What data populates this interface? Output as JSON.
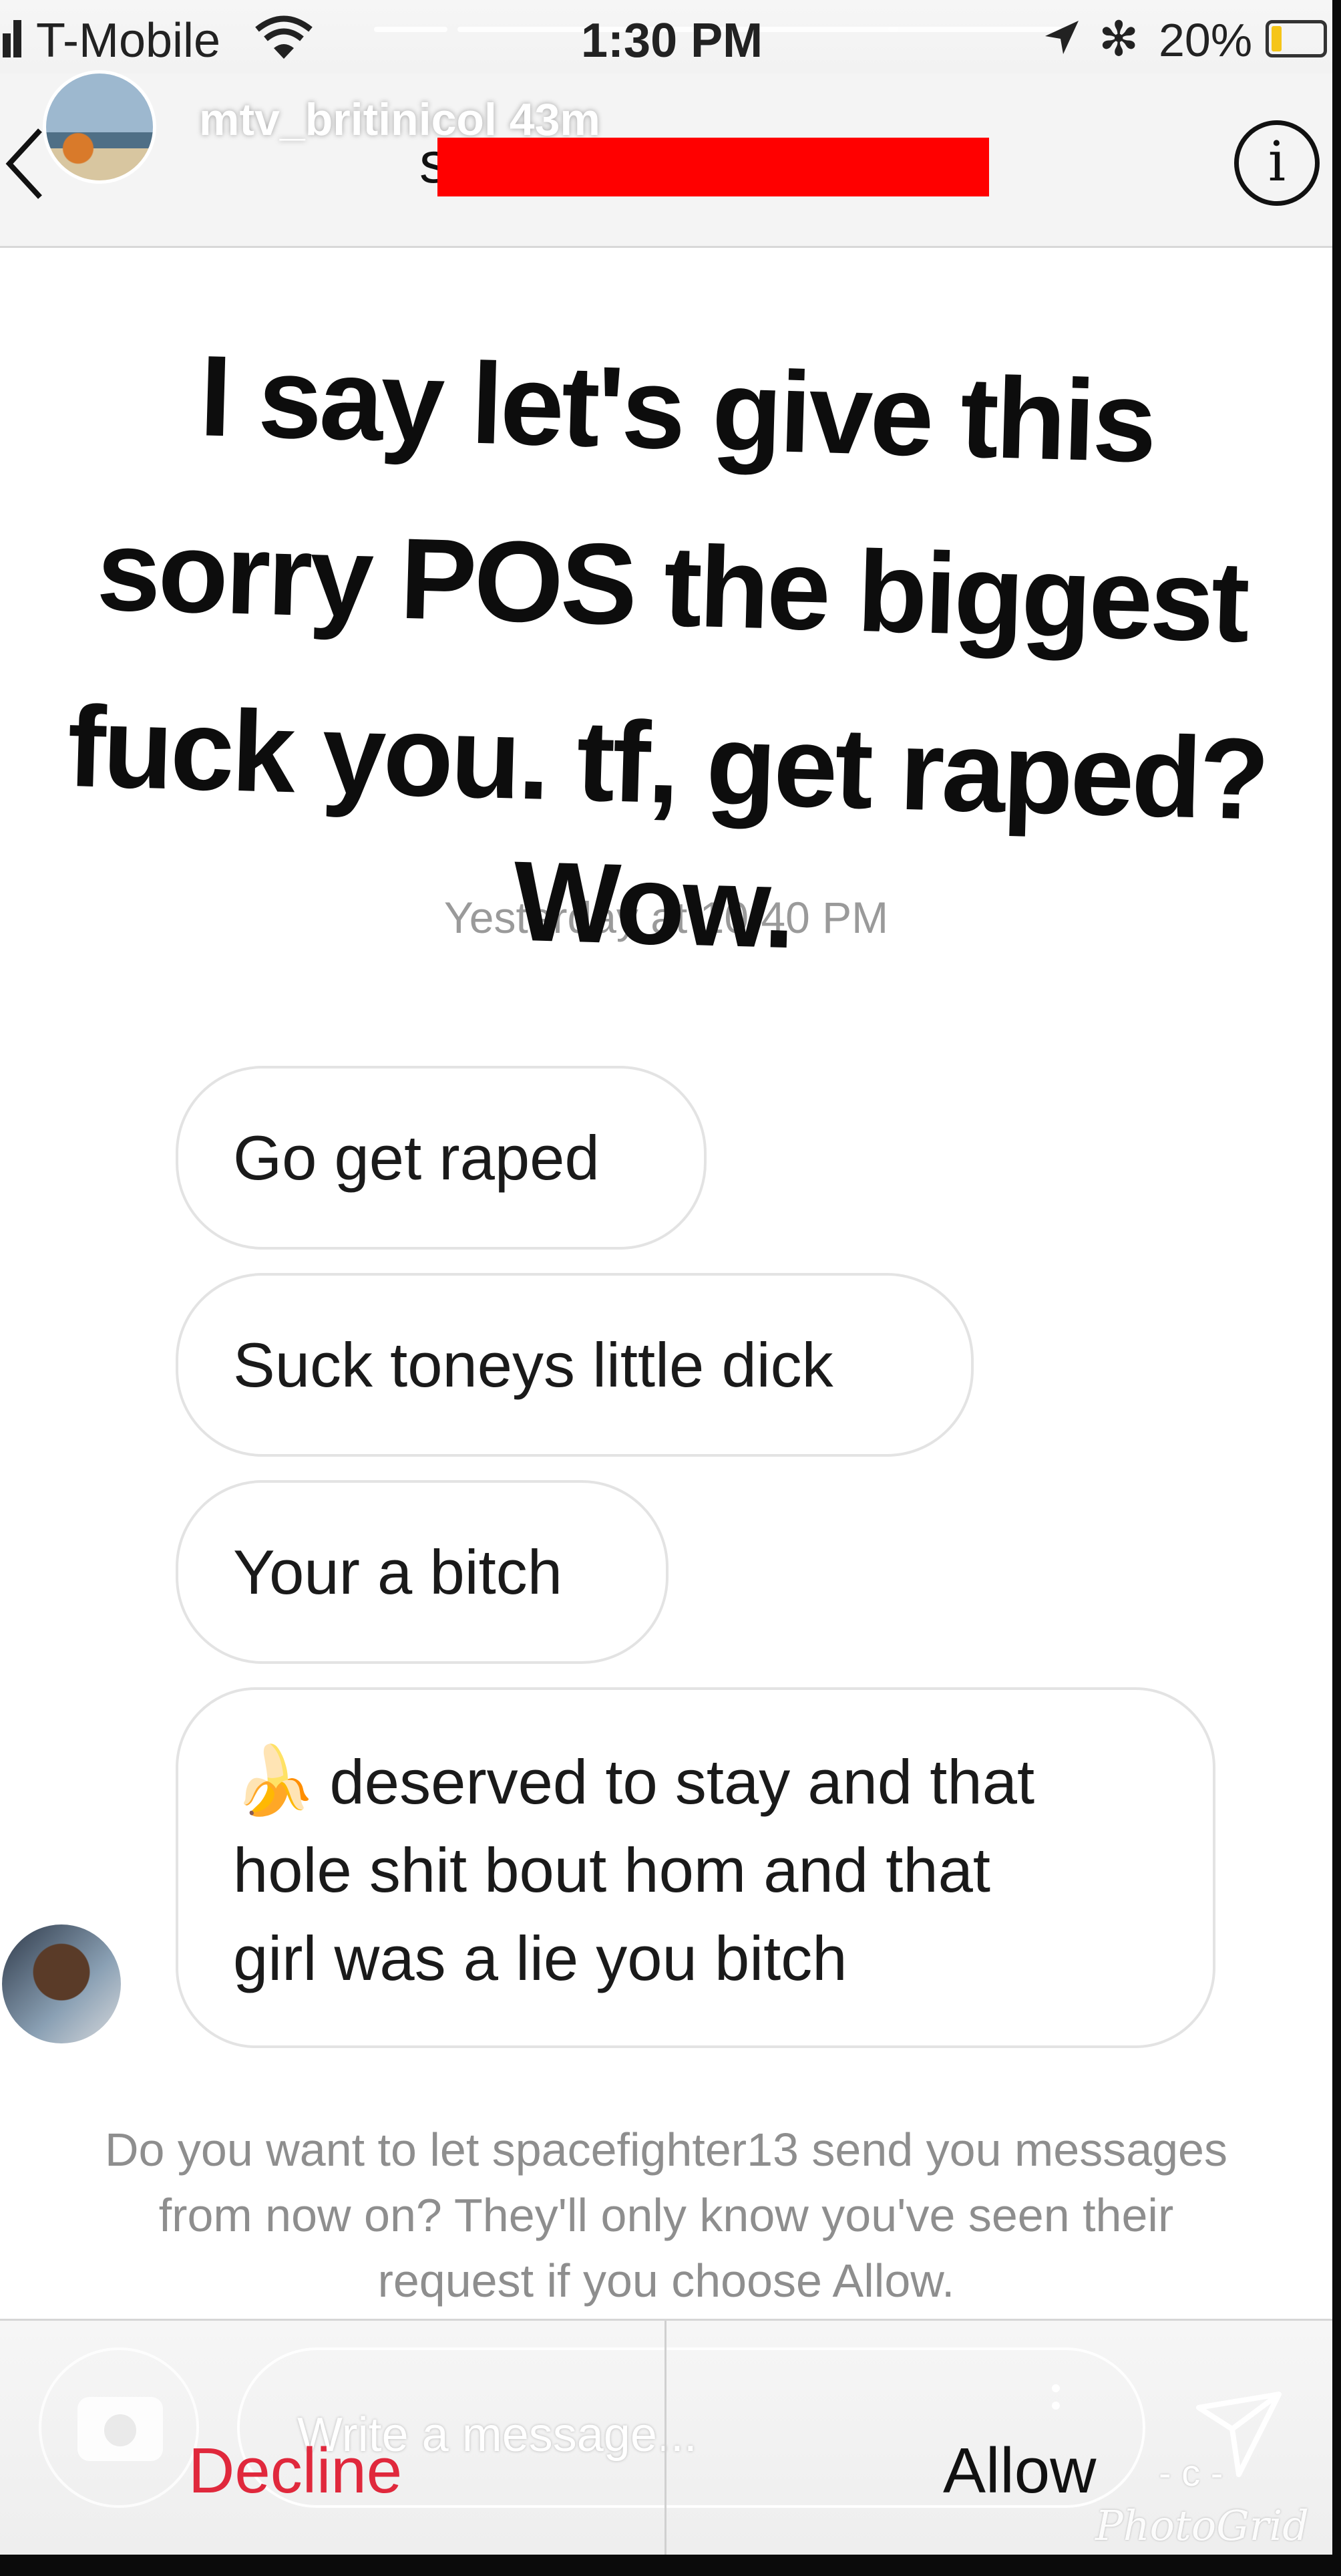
{
  "status_bar": {
    "carrier": "T-Mobile",
    "time": "1:30 PM",
    "battery_percent": "20%",
    "battery_level": 0.2
  },
  "story": {
    "username": "mtv_britinicol",
    "age": "43m"
  },
  "header": {
    "partial_title": "s",
    "info_label": "i"
  },
  "caption": {
    "lines": [
      "I say let's give this",
      "sorry POS the biggest",
      "fuck you. tf, get raped?",
      "Wow."
    ]
  },
  "conversation": {
    "timestamp": "Yesterday at 10:40 PM",
    "messages": [
      "Go get raped",
      "Suck toneys little dick",
      "Your a bitch",
      "deserved to stay and that hole shit bout hom and that girl was a lie you bitch"
    ],
    "last_message_lines": [
      "deserved to stay and that",
      "hole shit bout hom and that",
      "girl was a lie you bitch"
    ]
  },
  "request": {
    "text_lines": [
      "Do you want to let spacefighter13 send you messages",
      "from now on? They'll only know you've seen their",
      "request if you choose Allow."
    ]
  },
  "actions": {
    "decline_label": "Decline",
    "allow_label": "Allow",
    "message_placeholder": "Write a message..."
  },
  "watermark": {
    "text": "PhotoGrid",
    "mark": "- c -"
  },
  "colors": {
    "decline": "#e0283c",
    "redaction": "#ff0000",
    "timestamp": "#9a9a9a"
  }
}
